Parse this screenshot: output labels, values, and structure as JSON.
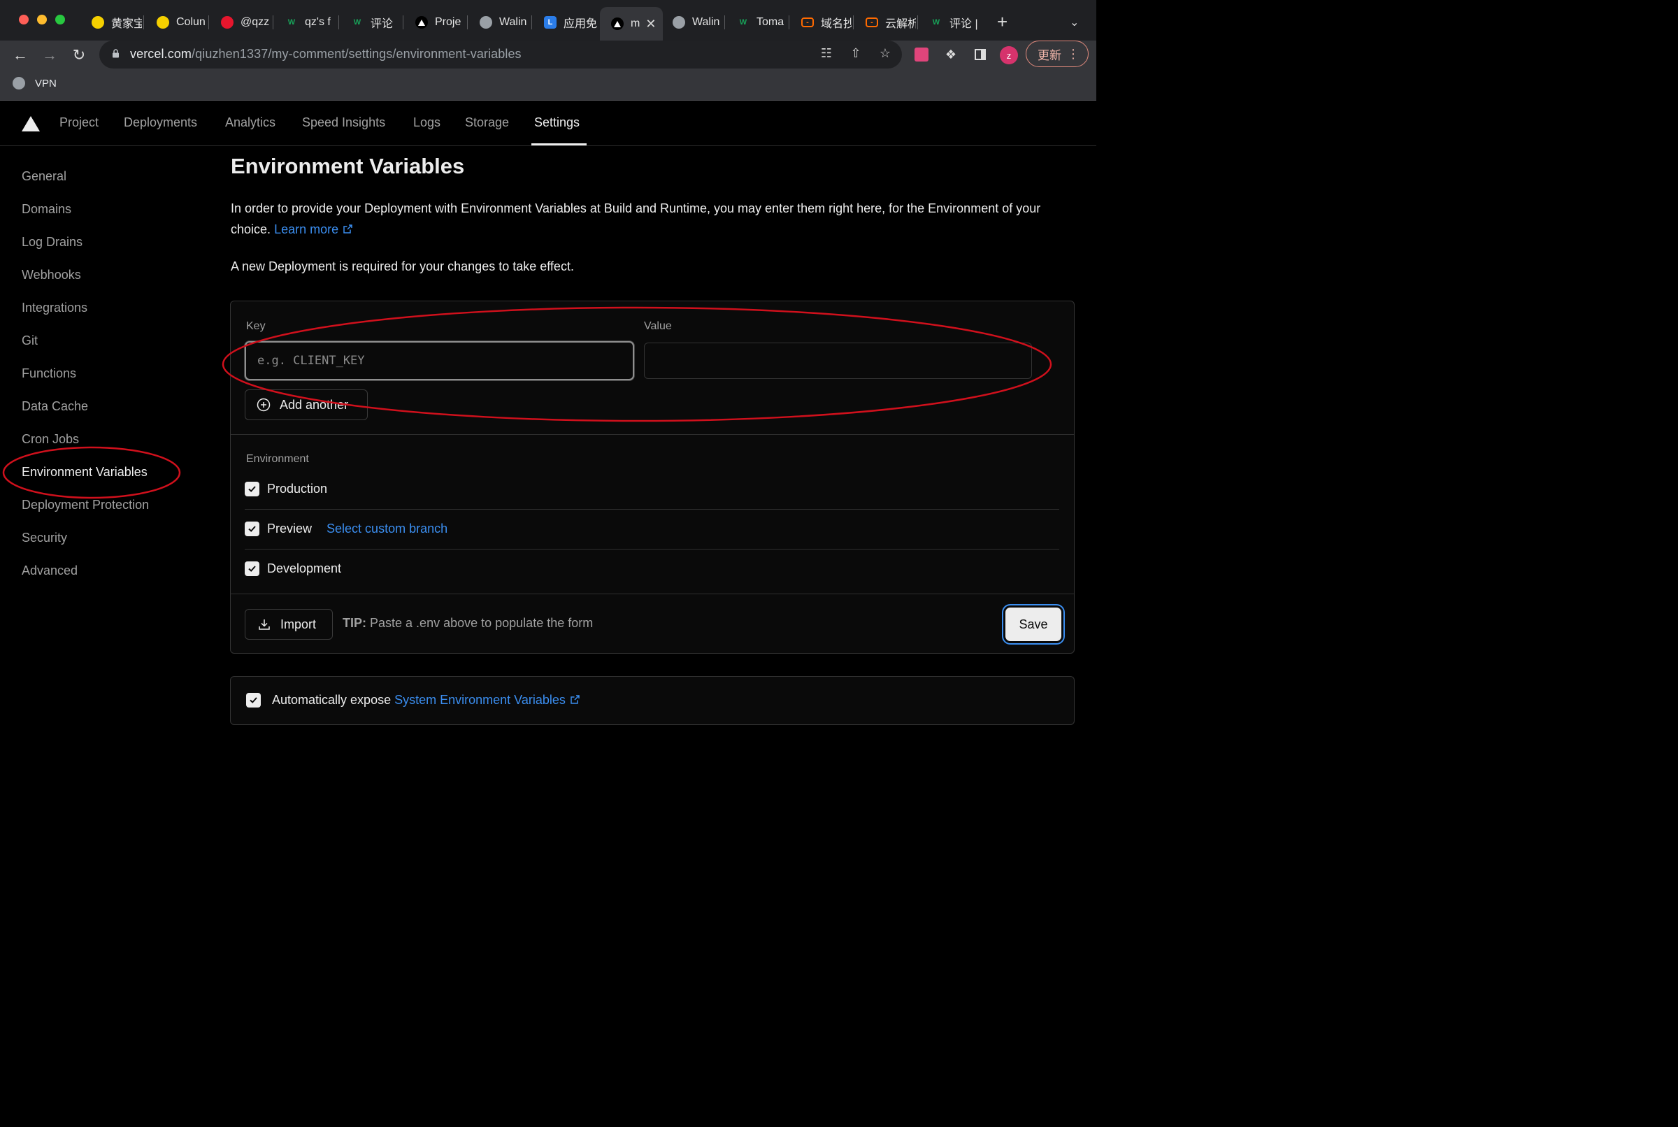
{
  "browser": {
    "tabs": [
      {
        "label": "黄家宝",
        "favicon": "emoji-face-icon",
        "fav_color": "#f5d000"
      },
      {
        "label": "Colun",
        "favicon": "emoji-face-icon",
        "fav_color": "#f5d000"
      },
      {
        "label": "@qzz",
        "favicon": "weibo-icon",
        "fav_color": "#e6162d"
      },
      {
        "label": "qz's f",
        "favicon": "walinejs-icon",
        "fav_color": "#18a058"
      },
      {
        "label": "评论",
        "favicon": "walinejs-icon",
        "fav_color": "#18a058"
      },
      {
        "label": "Proje",
        "favicon": "vercel-icon",
        "fav_color": "#ffffff"
      },
      {
        "label": "Walin",
        "favicon": "globe-icon",
        "fav_color": "#9aa0a6"
      },
      {
        "label": "应用免",
        "favicon": "leancloud-icon",
        "fav_color": "#2b7de9"
      },
      {
        "label": "m",
        "favicon": "vercel-icon",
        "fav_color": "#ffffff",
        "active": true
      },
      {
        "label": "Walin",
        "favicon": "globe-icon",
        "fav_color": "#9aa0a6"
      },
      {
        "label": "Toma",
        "favicon": "walinejs-icon",
        "fav_color": "#18a058"
      },
      {
        "label": "域名抄",
        "favicon": "aliyun-icon",
        "fav_color": "#ff6a00"
      },
      {
        "label": "云解析",
        "favicon": "aliyun-icon",
        "fav_color": "#ff6a00"
      },
      {
        "label": "评论 |",
        "favicon": "walinejs-icon",
        "fav_color": "#18a058"
      }
    ],
    "url_domain": "vercel.com",
    "url_path": "/qiuzhen1337/my-comment/settings/environment-variables",
    "avatar_letter": "z",
    "update_label": "更新",
    "bookmark_label": "VPN"
  },
  "topnav": {
    "items": [
      "Project",
      "Deployments",
      "Analytics",
      "Speed Insights",
      "Logs",
      "Storage",
      "Settings"
    ],
    "active": "Settings"
  },
  "sidebar": {
    "items": [
      "General",
      "Domains",
      "Log Drains",
      "Webhooks",
      "Integrations",
      "Git",
      "Functions",
      "Data Cache",
      "Cron Jobs",
      "Environment Variables",
      "Deployment Protection",
      "Security",
      "Advanced"
    ],
    "active": "Environment Variables"
  },
  "main": {
    "title": "Environment Variables",
    "description": "In order to provide your Deployment with Environment Variables at Build and Runtime, you may enter them right here, for the Environment of your choice.",
    "learn_more": "Learn more",
    "notice": "A new Deployment is required for your changes to take effect."
  },
  "form": {
    "key_label": "Key",
    "key_placeholder": "e.g. CLIENT_KEY",
    "key_value": "",
    "value_label": "Value",
    "value_value": "",
    "add_another": "Add another",
    "environment_label": "Environment",
    "environments": [
      {
        "label": "Production",
        "checked": true
      },
      {
        "label": "Preview",
        "checked": true,
        "extra_link": "Select custom branch"
      },
      {
        "label": "Development",
        "checked": true
      }
    ],
    "import_label": "Import",
    "tip_prefix": "TIP:",
    "tip_text": "Paste a .env above to populate the form",
    "save_label": "Save"
  },
  "system_env": {
    "checked": true,
    "text": "Automatically expose",
    "link": "System Environment Variables"
  },
  "colors": {
    "accent_link": "#3b8ef0",
    "annotation": "#d0101c",
    "background": "#000000"
  }
}
